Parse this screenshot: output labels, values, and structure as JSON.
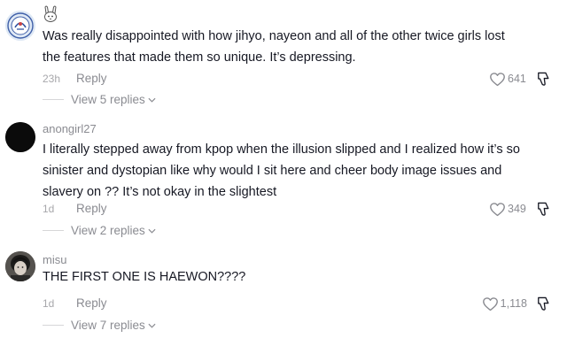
{
  "comments": [
    {
      "username": "",
      "avatar_icon": "round-logo-avatar",
      "badge_icon": "bunny-emoji-icon",
      "text_lines": [
        "Was really disappointed with how jihyo, nayeon and all of the other twice girls lost",
        "the features that made them so unique. It’s depressing."
      ],
      "time": "23h",
      "reply_label": "Reply",
      "likes": "641",
      "view_replies": "View 5 replies"
    },
    {
      "username": "anongirl27",
      "avatar_icon": "black-circle-avatar",
      "text_lines": [
        "I literally stepped away from kpop when the illusion slipped and I realized how it’s so",
        "sinister and dystopian like why would I sit here and cheer body image issues and",
        "slavery on ?? It’s not okay in the slightest"
      ],
      "time": "1d",
      "reply_label": "Reply",
      "likes": "349",
      "view_replies": "View 2 replies"
    },
    {
      "username": "misu",
      "avatar_icon": "photo-avatar",
      "text_lines": [
        "THE FIRST ONE IS HAEWON????"
      ],
      "time": "1d",
      "reply_label": "Reply",
      "likes": "1,118",
      "view_replies": "View 7 replies"
    }
  ],
  "colors": {
    "text": "#161823",
    "secondary": "#8a8b91",
    "timestamp": "#a7a7ab"
  }
}
